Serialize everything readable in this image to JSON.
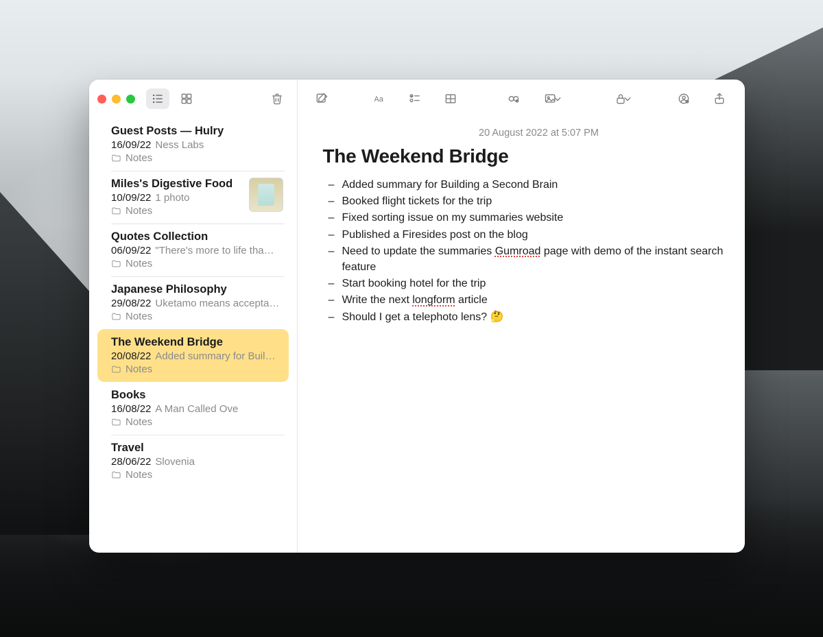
{
  "sidebar": {
    "items": [
      {
        "title": "Guest Posts — Hulry",
        "date": "16/09/22",
        "preview": "Ness Labs",
        "folder": "Notes"
      },
      {
        "title": "Miles's Digestive Food",
        "date": "10/09/22",
        "preview": "1 photo",
        "folder": "Notes",
        "has_thumbnail": true
      },
      {
        "title": "Quotes Collection",
        "date": "06/09/22",
        "preview": "\"There's more to life tha…",
        "folder": "Notes"
      },
      {
        "title": "Japanese Philosophy",
        "date": "29/08/22",
        "preview": "Uketamo means accepta…",
        "folder": "Notes"
      },
      {
        "title": "The Weekend Bridge",
        "date": "20/08/22",
        "preview": "Added summary for Buil…",
        "folder": "Notes",
        "selected": true
      },
      {
        "title": "Books",
        "date": "16/08/22",
        "preview": "A Man Called Ove",
        "folder": "Notes"
      },
      {
        "title": "Travel",
        "date": "28/06/22",
        "preview": "Slovenia",
        "folder": "Notes"
      }
    ]
  },
  "note": {
    "timestamp": "20 August 2022 at 5:07 PM",
    "title": "The Weekend Bridge",
    "bullets": {
      "0": "Added summary for Building a Second Brain",
      "1": "Booked flight tickets for the trip",
      "2": "Fixed sorting issue on my summaries website",
      "3": "Published a Firesides post on the blog",
      "4a": "Need to update the summaries",
      "4s": "Gumroad",
      "4b": "page with demo of the instant search feature",
      "5": "Start booking hotel for the trip",
      "6a": "Write the next",
      "6s": "longform",
      "6b": "article",
      "7": "Should I get a telephoto lens? 🤔"
    }
  },
  "colors": {
    "selection": "#ffe089",
    "text_secondary": "#8a8a8f",
    "spellcheck_underline": "#e0423f"
  }
}
